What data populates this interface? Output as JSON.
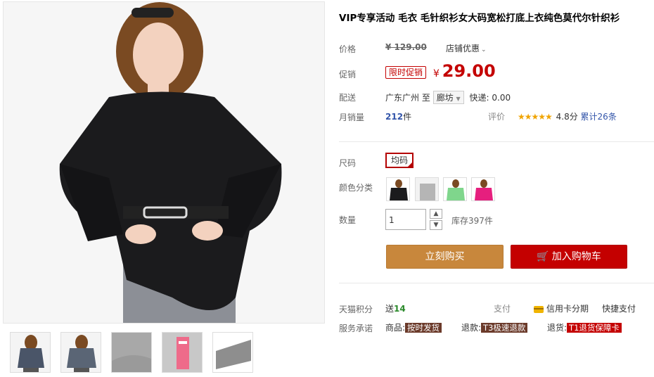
{
  "product": {
    "title": "VIP专享活动 毛衣 毛针织衫女大码宽松打底上衣纯色莫代尔针织衫"
  },
  "price": {
    "label": "价格",
    "original": "¥ 129.00",
    "shop_coupon": "店铺优惠"
  },
  "promo": {
    "label": "促销",
    "badge": "限时促销",
    "currency": "¥",
    "price": "29.00"
  },
  "shipping": {
    "label": "配送",
    "from": "广东广州",
    "to_word": "至",
    "to_city": "廊坊",
    "express": "快递: 0.00"
  },
  "sales": {
    "label": "月销量",
    "count": "212",
    "unit": "件",
    "review_label": "评价",
    "stars": "★★★★★",
    "rating": "4.8分",
    "total_reviews": "累计26条"
  },
  "options": {
    "size_label": "尺码",
    "size_value": "均码",
    "color_label": "颜色分类"
  },
  "quantity": {
    "label": "数量",
    "value": "1",
    "stock": "库存397件"
  },
  "buttons": {
    "buy_now": "立刻购买",
    "add_to_cart": "加入购物车"
  },
  "points": {
    "label": "天猫积分",
    "give": "送",
    "amount": "14",
    "pay_label": "支付",
    "installment": "信用卡分期",
    "quick_pay": "快捷支付"
  },
  "service": {
    "label": "服务承诺",
    "goods_prefix": "商品:",
    "goods_tag": "按时发货",
    "refund_prefix": "退款:",
    "refund_tag": "T3极速退款",
    "return_prefix": "退货:",
    "return_tag": "T1退货保障卡"
  },
  "icons": [
    "chevron-down-icon",
    "cart-icon",
    "credit-card-icon",
    "star-icon",
    "check-corner-icon"
  ],
  "colors": {
    "accent_red": "#c40000",
    "buy_orange": "#c8873c",
    "star": "#f0a400"
  }
}
